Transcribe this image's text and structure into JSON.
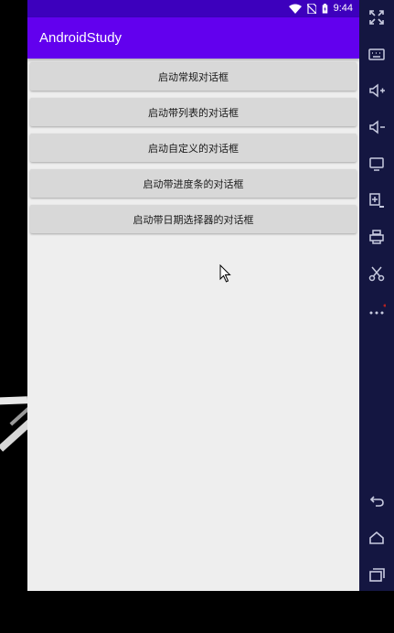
{
  "status_bar": {
    "time": "9:44"
  },
  "app_bar": {
    "title": "AndroidStudy"
  },
  "buttons": [
    {
      "label": "启动常规对话框"
    },
    {
      "label": "启动带列表的对话框"
    },
    {
      "label": "启动自定义的对话框"
    },
    {
      "label": "启动带进度条的对话框"
    },
    {
      "label": "启动带日期选择器的对话框"
    }
  ],
  "emulator_toolbar": {
    "icons": [
      "fullscreen-icon",
      "keyboard-icon",
      "volume-up-icon",
      "volume-down-icon",
      "screen-icon",
      "install-apk-icon",
      "print-icon",
      "cut-icon",
      "more-icon",
      "back-icon",
      "home-icon",
      "recents-icon"
    ]
  },
  "colors": {
    "status_bar": "#3d00bd",
    "app_bar": "#6200ee",
    "background": "#eeeeee",
    "button": "#d8d8d8",
    "toolbar": "#141641"
  }
}
